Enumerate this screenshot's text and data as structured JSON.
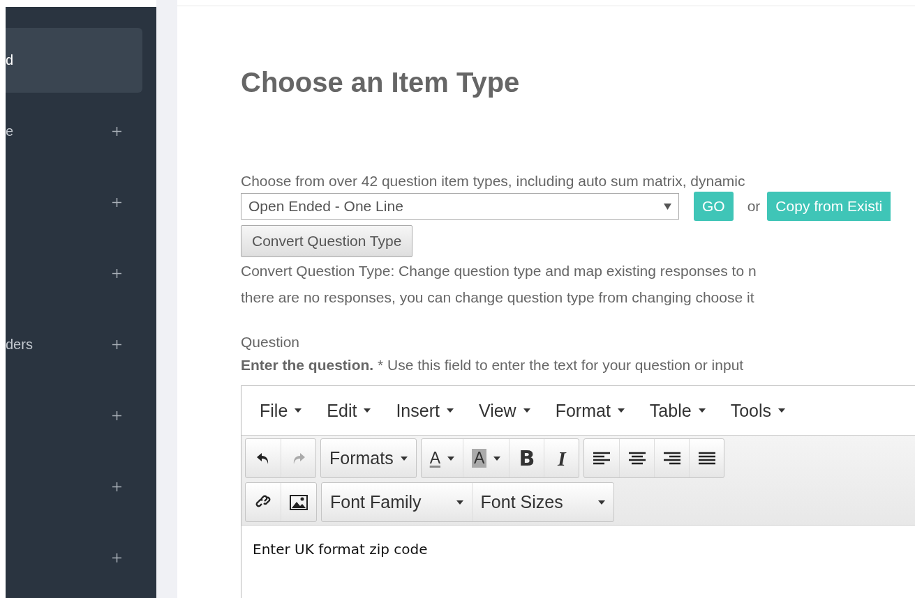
{
  "sidebar": {
    "items": [
      {
        "label": "d",
        "selected": true,
        "kind": "link"
      },
      {
        "label": "e",
        "selected": false,
        "kind": "group"
      },
      {
        "selected": false,
        "kind": "group"
      },
      {
        "selected": false,
        "kind": "group"
      },
      {
        "label": "ders",
        "selected": false,
        "kind": "group"
      },
      {
        "selected": false,
        "kind": "group"
      },
      {
        "selected": false,
        "kind": "group"
      },
      {
        "selected": false,
        "kind": "group"
      }
    ]
  },
  "page": {
    "title": "Choose an Item Type",
    "intro": "Choose from over 42 question item types, including auto sum matrix, dynamic",
    "item_type_select": {
      "value": "Open Ended - One Line"
    },
    "go_button": "GO",
    "or_text": "or",
    "copy_button": "Copy from Existi",
    "convert_button": "Convert Question Type",
    "convert_help": [
      "Convert Question Type: Change question type and map existing responses to n",
      "there are no responses, you can change question type from changing choose it"
    ],
    "question_label": "Question",
    "question_help": "**Enter the question.** * Use this field to enter the text for your question or input"
  },
  "editor": {
    "menu": [
      "File",
      "Edit",
      "Insert",
      "View",
      "Format",
      "Table",
      "Tools"
    ],
    "toolbar_rows": [
      [
        {
          "items": [
            {
              "kind": "undo",
              "disabled": false
            },
            {
              "kind": "redo",
              "disabled": true
            }
          ]
        },
        {
          "items": [
            {
              "kind": "dropdown",
              "label": "Formats"
            }
          ]
        },
        {
          "items": [
            {
              "kind": "forecolor",
              "label": "A"
            },
            {
              "kind": "backcolor",
              "label": "A"
            },
            {
              "kind": "bold",
              "label": "B"
            },
            {
              "kind": "italic",
              "label": "I"
            }
          ]
        },
        {
          "items": [
            {
              "kind": "align-left"
            },
            {
              "kind": "align-center"
            },
            {
              "kind": "align-right"
            },
            {
              "kind": "justify"
            }
          ]
        }
      ],
      [
        {
          "items": [
            {
              "kind": "link"
            },
            {
              "kind": "image"
            }
          ]
        },
        {
          "items": [
            {
              "kind": "wide-dropdown",
              "label": "Font Family"
            },
            {
              "kind": "wide-dropdown",
              "label": "Font Sizes"
            }
          ]
        }
      ]
    ],
    "content": "Enter UK format zip code"
  }
}
